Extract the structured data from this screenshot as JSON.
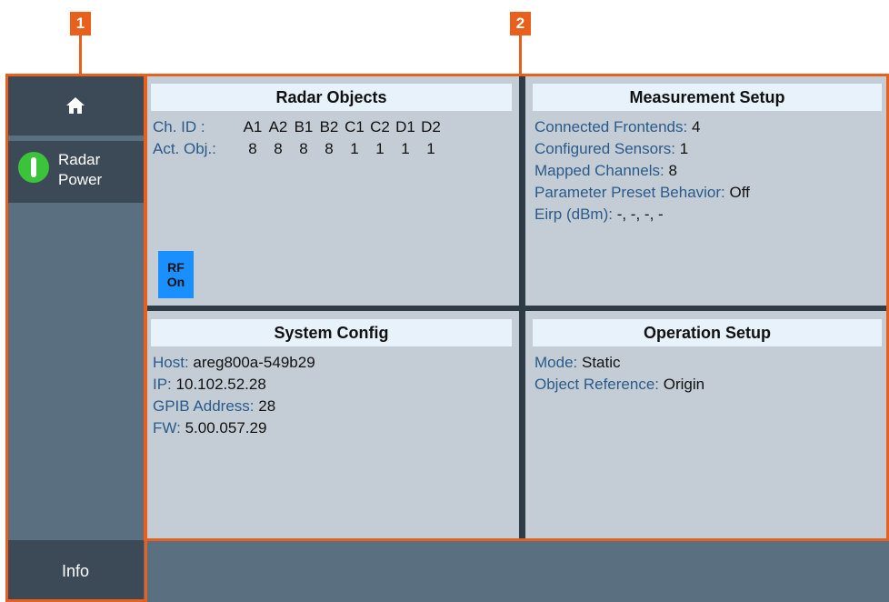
{
  "callouts": {
    "one": "1",
    "two": "2"
  },
  "sidebar": {
    "radar_label_1": "Radar",
    "radar_label_2": "Power",
    "info_label": "Info"
  },
  "radar_objects": {
    "title": "Radar Objects",
    "ch_id_label": "Ch. ID :",
    "channels": [
      "A1",
      "A2",
      "B1",
      "B2",
      "C1",
      "C2",
      "D1",
      "D2"
    ],
    "act_obj_label": "Act. Obj.:",
    "active_objects": [
      "8",
      "8",
      "8",
      "8",
      "1",
      "1",
      "1",
      "1"
    ],
    "rf_line1": "RF",
    "rf_line2": "On"
  },
  "measurement_setup": {
    "title": "Measurement Setup",
    "rows": [
      {
        "label": "Connected Frontends:",
        "value": "4"
      },
      {
        "label": "Configured Sensors:",
        "value": "1"
      },
      {
        "label": "Mapped Channels:",
        "value": "8"
      },
      {
        "label": "Parameter Preset Behavior:",
        "value": "Off"
      },
      {
        "label": "Eirp (dBm):",
        "value": "-, -, -, -"
      }
    ]
  },
  "system_config": {
    "title": "System Config",
    "rows": [
      {
        "label": "Host:",
        "value": "areg800a-549b29"
      },
      {
        "label": "IP:",
        "value": "10.102.52.28"
      },
      {
        "label": "GPIB Address:",
        "value": "28"
      },
      {
        "label": "FW:",
        "value": "5.00.057.29"
      }
    ]
  },
  "operation_setup": {
    "title": "Operation Setup",
    "rows": [
      {
        "label": "Mode:",
        "value": "Static"
      },
      {
        "label": "Object Reference:",
        "value": "Origin"
      }
    ]
  },
  "colors": {
    "callout": "#e8601c",
    "sidebar": "#5a6f80",
    "sidebar_button": "#3c4a57",
    "panel": "#c4cdd5",
    "panel_title": "#e8f2fb",
    "label_blue": "#2a5a8a",
    "rf_on": "#1a8fff",
    "power_on": "#3bc43b"
  },
  "icons": {
    "home": "home-icon",
    "power": "power-indicator-icon"
  }
}
